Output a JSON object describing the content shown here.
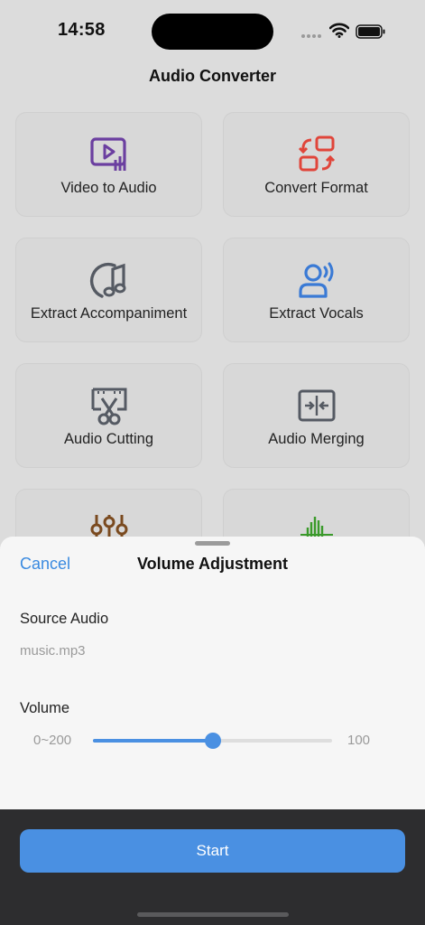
{
  "status_bar": {
    "time": "14:58"
  },
  "app": {
    "title": "Audio Converter"
  },
  "tools": [
    {
      "label": "Video to Audio",
      "icon": "video-to-audio-icon",
      "color": "#6b3fa0"
    },
    {
      "label": "Convert Format",
      "icon": "convert-format-icon",
      "color": "#e0453a"
    },
    {
      "label": "Extract Accompaniment",
      "icon": "music-note-icon",
      "color": "#555a63"
    },
    {
      "label": "Extract Vocals",
      "icon": "vocals-person-icon",
      "color": "#3a7ad5"
    },
    {
      "label": "Audio Cutting",
      "icon": "scissors-film-icon",
      "color": "#555a63"
    },
    {
      "label": "Audio Merging",
      "icon": "merge-arrows-icon",
      "color": "#555a63"
    },
    {
      "label": "",
      "icon": "equalizer-icon",
      "color": "#7a4a1f"
    },
    {
      "label": "",
      "icon": "waveform-icon",
      "color": "#3a9a2a"
    }
  ],
  "sheet": {
    "cancel_label": "Cancel",
    "title": "Volume Adjustment",
    "source_label": "Source Audio",
    "source_value": "music.mp3",
    "volume_label": "Volume",
    "range_label": "0~200",
    "volume_value": "100",
    "volume_fraction": 0.5
  },
  "footer": {
    "start_label": "Start"
  },
  "colors": {
    "accent": "#4a90e2",
    "footer_bg": "#2d2d2f"
  }
}
